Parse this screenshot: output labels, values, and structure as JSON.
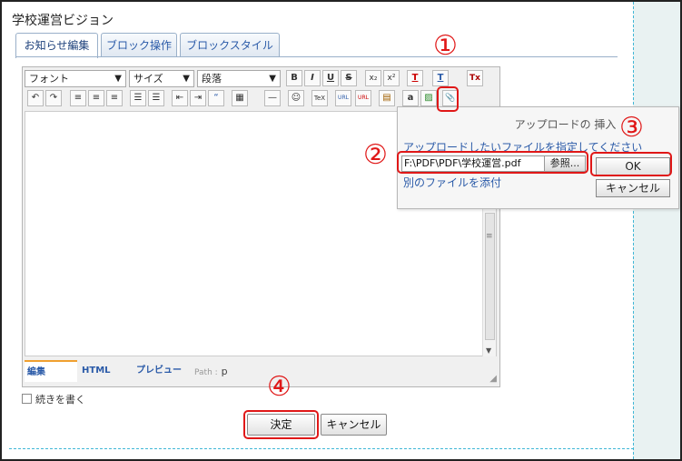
{
  "page_title": "学校運営ビジョン",
  "tabs": [
    "お知らせ編集",
    "ブロック操作",
    "ブロックスタイル"
  ],
  "toolbar": {
    "font_select": "フォント",
    "size_select": "サイズ",
    "format_select": "段落",
    "buttons": {
      "bold": "B",
      "italic": "I",
      "underline": "U",
      "strike": "S",
      "subscript": "x₂",
      "superscript": "x²",
      "text_color": "T",
      "bg_color": "T",
      "remove_format": "Tx",
      "undo": "↶",
      "redo": "↷",
      "align_left": "≡",
      "align_center": "≡",
      "align_right": "≡",
      "ol": "☰",
      "ul": "☰",
      "outdent": "⇤",
      "indent": "⇥",
      "quote": "“",
      "table": "▦",
      "hr": "—",
      "emoticon": "☺",
      "tex": "TeX",
      "url": "URL",
      "unlink": "URL",
      "clip": "▤",
      "amazon": "a",
      "image": "▨",
      "attach": "📎"
    }
  },
  "editor_footer": {
    "tab_edit": "編集",
    "tab_html": "HTML",
    "tab_preview": "プレビュー",
    "path_label": "Path :",
    "path_value": "p"
  },
  "dialog": {
    "title": "アップロードの 挿入",
    "message": "アップロードしたいファイルを指定してください",
    "file_value": "F:\\PDF\\PDF\\学校運営.pdf",
    "browse_label": "参照...",
    "attach_another": "別のファイルを添付",
    "ok_label": "OK",
    "cancel_label": "キャンセル"
  },
  "continue_label": "続きを書く",
  "actions": {
    "confirm": "決定",
    "cancel": "キャンセル"
  },
  "markers": [
    "①",
    "②",
    "③",
    "④"
  ],
  "colors": {
    "marker_red": "#e01818",
    "link_blue": "#2a5aa8",
    "tab_border": "#9ab0c9",
    "dashed_accent": "#3fb7d6"
  }
}
